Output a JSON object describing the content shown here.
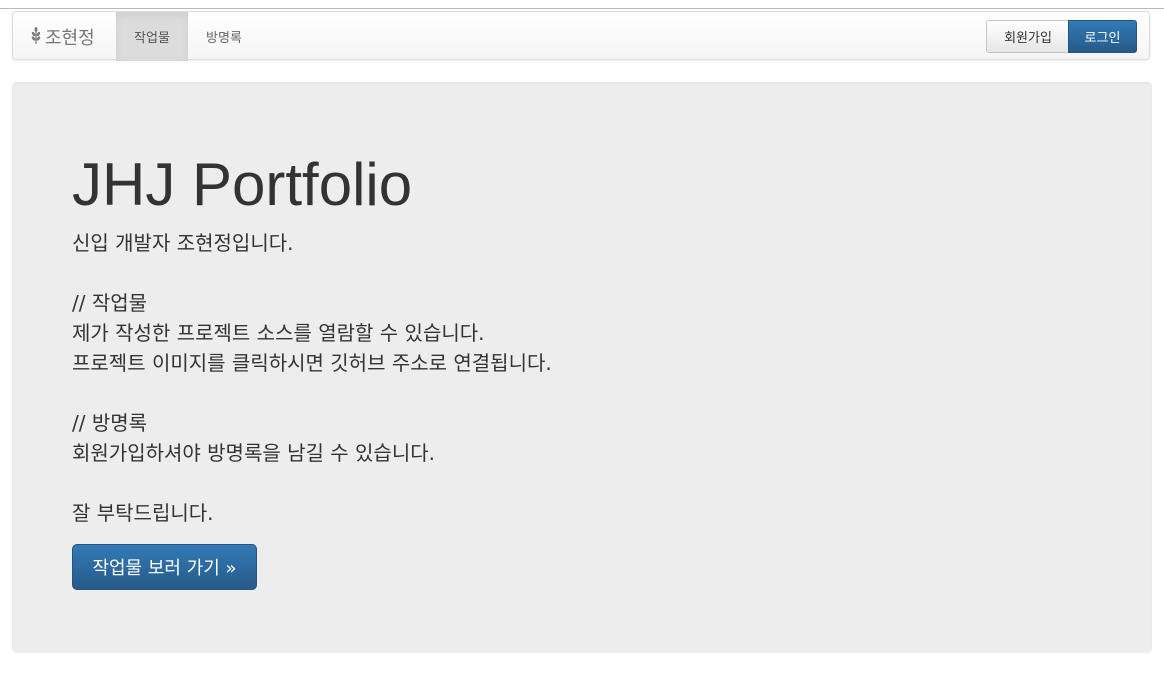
{
  "nav": {
    "brand": "조현정",
    "brand_icon": "wheat-icon",
    "tabs": [
      {
        "label": "작업물",
        "active": true
      },
      {
        "label": "방명록",
        "active": false
      }
    ],
    "signup_label": "회원가입",
    "login_label": "로그인"
  },
  "hero": {
    "title": "JHJ Portfolio",
    "intro": "신입 개발자 조현정입니다.",
    "works_heading": "// 작업물",
    "works_line1": "제가 작성한 프로젝트 소스를 열람할 수 있습니다.",
    "works_line2": "프로젝트 이미지를 클릭하시면 깃허브 주소로 연결됩니다.",
    "guest_heading": "// 방명록",
    "guest_line": "회원가입하셔야 방명록을 남길 수 있습니다.",
    "closing": "잘 부탁드립니다.",
    "cta_label": "작업물 보러 가기 »"
  },
  "colors": {
    "primary": "#337ab7",
    "jumbotron_bg": "#ededed",
    "text": "#333333"
  }
}
